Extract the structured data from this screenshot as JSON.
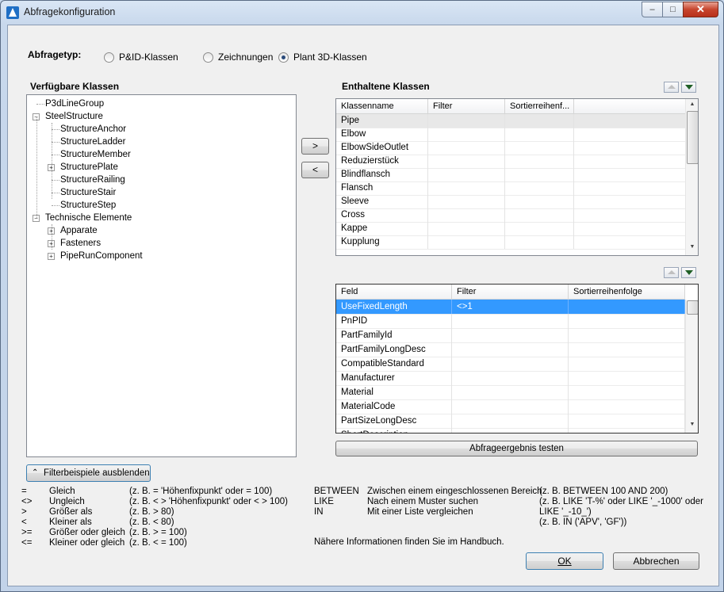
{
  "window": {
    "title": "Abfragekonfiguration",
    "controls": {
      "minimize": "‒",
      "maximize": "□",
      "close": "✕"
    }
  },
  "query_type": {
    "label": "Abfragetyp:",
    "options": [
      {
        "label": "P&ID-Klassen",
        "selected": false
      },
      {
        "label": "Zeichnungen",
        "selected": false
      },
      {
        "label": "Plant 3D-Klassen",
        "selected": true
      }
    ]
  },
  "available_classes": {
    "heading": "Verfügbare Klassen",
    "tree": [
      {
        "label": "P3dLineGroup",
        "expander": ""
      },
      {
        "label": "SteelStructure",
        "expander": "−"
      },
      {
        "label": "StructureAnchor",
        "expander": ""
      },
      {
        "label": "StructureLadder",
        "expander": ""
      },
      {
        "label": "StructureMember",
        "expander": ""
      },
      {
        "label": "StructurePlate",
        "expander": "+"
      },
      {
        "label": "StructureRailing",
        "expander": ""
      },
      {
        "label": "StructureStair",
        "expander": ""
      },
      {
        "label": "StructureStep",
        "expander": ""
      },
      {
        "label": "Technische Elemente",
        "expander": "−"
      },
      {
        "label": "Apparate",
        "expander": "+"
      },
      {
        "label": "Fasteners",
        "expander": "+"
      },
      {
        "label": "PipeRunComponent",
        "expander": "+"
      }
    ]
  },
  "move_buttons": {
    "add": ">",
    "remove": "<"
  },
  "contained_classes": {
    "heading": "Enthaltene Klassen",
    "columns": [
      "Klassenname",
      "Filter",
      "Sortierreihenf..."
    ],
    "rows": [
      "Pipe",
      "Elbow",
      "ElbowSideOutlet",
      "Reduzierstück",
      "Blindflansch",
      "Flansch",
      "Sleeve",
      "Cross",
      "Kappe",
      "Kupplung"
    ]
  },
  "fields": {
    "columns": [
      "Feld",
      "Filter",
      "Sortierreihenfolge"
    ],
    "rows": [
      {
        "field": "UseFixedLength",
        "filter": "<>1",
        "selected": true
      },
      {
        "field": "PnPID",
        "filter": ""
      },
      {
        "field": "PartFamilyId",
        "filter": ""
      },
      {
        "field": "PartFamilyLongDesc",
        "filter": ""
      },
      {
        "field": "CompatibleStandard",
        "filter": ""
      },
      {
        "field": "Manufacturer",
        "filter": ""
      },
      {
        "field": "Material",
        "filter": ""
      },
      {
        "field": "MaterialCode",
        "filter": ""
      },
      {
        "field": "PartSizeLongDesc",
        "filter": ""
      },
      {
        "field": "ShortDescription",
        "filter": ""
      }
    ],
    "selection_color": "#3399ff"
  },
  "test_button": "Abfrageergebnis testen",
  "hide_examples_button": "Filterbeispiele ausblenden",
  "operators": [
    {
      "op": "=",
      "name": "Gleich",
      "example": "(z. B. = 'Höhenfixpunkt' oder = 100)"
    },
    {
      "op": "<>",
      "name": "Ungleich",
      "example": "(z. B. < > 'Höhenfixpunkt' oder < > 100)"
    },
    {
      "op": ">",
      "name": "Größer als",
      "example": "(z. B. > 80)"
    },
    {
      "op": "<",
      "name": "Kleiner als",
      "example": "(z. B. < 80)"
    },
    {
      "op": ">=",
      "name": "Größer oder gleich",
      "example": "(z. B. > = 100)"
    },
    {
      "op": "<=",
      "name": "Kleiner oder gleich",
      "example": "(z. B. < = 100)"
    }
  ],
  "keywords": [
    {
      "kw": "BETWEEN",
      "desc": "Zwischen einem eingeschlossenen Bereich",
      "example": "(z. B. BETWEEN 100 AND 200)"
    },
    {
      "kw": "LIKE",
      "desc": "Nach einem Muster suchen",
      "example": "(z. B. LIKE 'T-%' oder LIKE '_-1000' oder"
    },
    {
      "kw": "IN",
      "desc": "Mit einer Liste vergleichen",
      "example": "LIKE '_-10_')"
    },
    {
      "kw": "",
      "desc": "",
      "example": "(z. B. IN ('APV', 'GF'))"
    }
  ],
  "handbook_note": "Nähere Informationen finden Sie im Handbuch.",
  "ok_button": "OK",
  "cancel_button": "Abbrechen"
}
